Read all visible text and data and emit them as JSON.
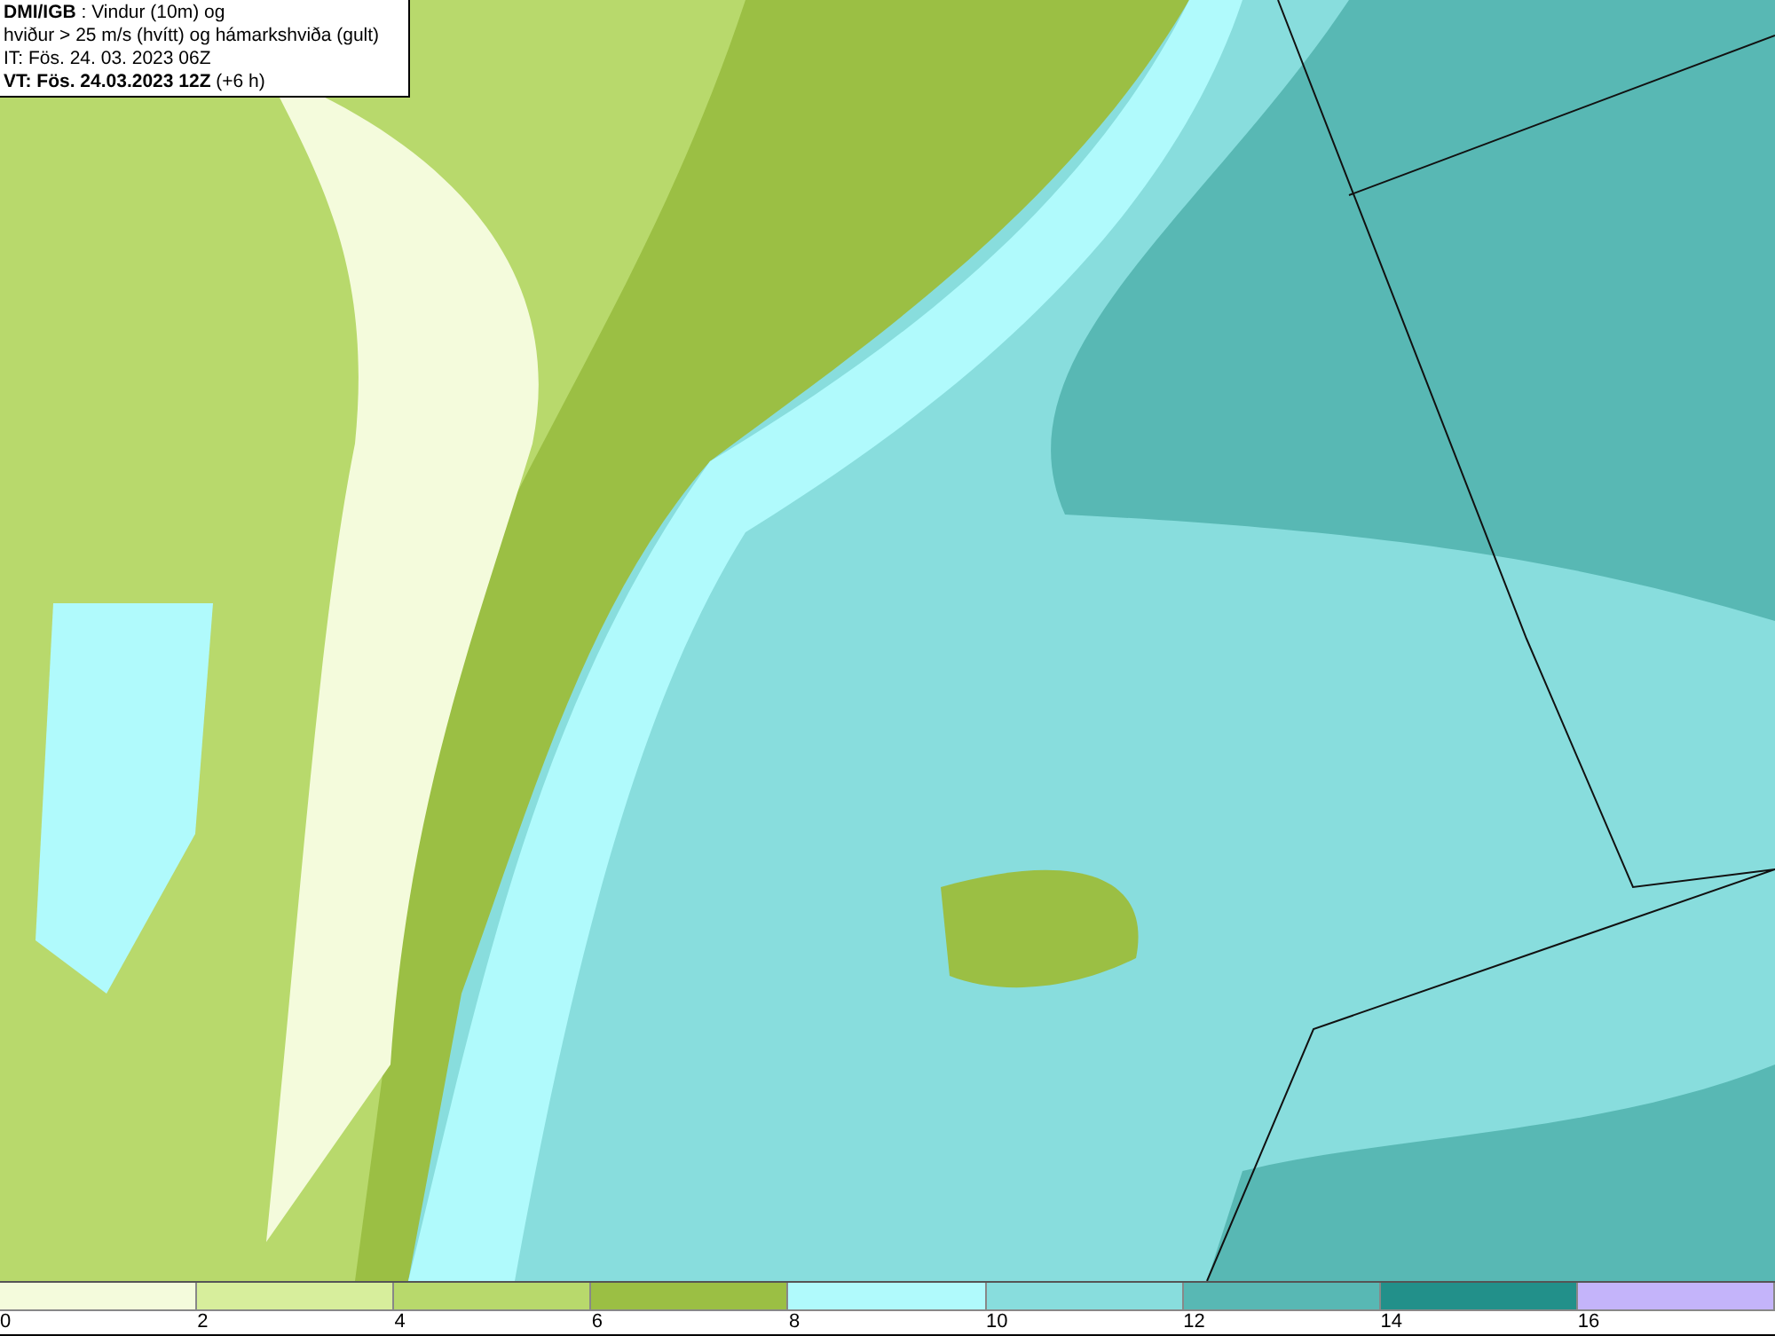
{
  "title_box": {
    "lines": [
      "**DMI/IGB** : Vindur (10m) og",
      "hviður > 25 m/s (hvítt) og hámarkshviða (gult)",
      "IT: Fös. 24. 03. 2023 06Z",
      "**VT: Fös. 24.03.2023 12Z** (+6 h)"
    ]
  },
  "legend": {
    "segments": [
      {
        "label": "0",
        "color": "#f4fbdc"
      },
      {
        "label": "2",
        "color": "#d7ee9c"
      },
      {
        "label": "4",
        "color": "#b8d96c"
      },
      {
        "label": "6",
        "color": "#9bbf44"
      },
      {
        "label": "8",
        "color": "#b0fafc"
      },
      {
        "label": "10",
        "color": "#88dddd"
      },
      {
        "label": "12",
        "color": "#58b8b4"
      },
      {
        "label": "14",
        "color": "#22908a"
      },
      {
        "label": "16",
        "color": "#c4b4fa"
      }
    ]
  }
}
